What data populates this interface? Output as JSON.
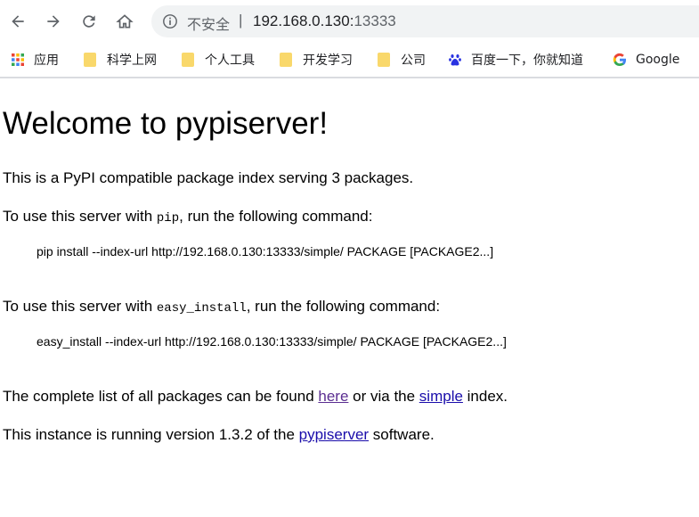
{
  "browser": {
    "security_label": "不安全",
    "url_host": "192.168.0.130:",
    "url_port": "13333",
    "bookmarks": [
      {
        "label": "应用",
        "icon": "apps-grid-icon"
      },
      {
        "label": "科学上网",
        "icon": "folder-icon"
      },
      {
        "label": "个人工具",
        "icon": "folder-icon"
      },
      {
        "label": "开发学习",
        "icon": "folder-icon"
      },
      {
        "label": "公司",
        "icon": "folder-icon"
      },
      {
        "label": "百度一下，你就知道",
        "icon": "baidu-paw-icon"
      },
      {
        "label": "Google",
        "icon": "google-g-icon"
      }
    ]
  },
  "page": {
    "heading": "Welcome to pypiserver!",
    "intro": "This is a PyPI compatible package index serving 3 packages.",
    "pip_prefix": "To use this server with ",
    "pip_code": "pip",
    "pip_suffix": ", run the following command:",
    "pip_command": "pip install --index-url http://192.168.0.130:13333/simple/ PACKAGE [PACKAGE2...]",
    "easy_prefix": "To use this server with ",
    "easy_code": "easy_install",
    "easy_suffix": ", run the following command:",
    "easy_command": "easy_install --index-url http://192.168.0.130:13333/simple/ PACKAGE [PACKAGE2...]",
    "list_prefix": "The complete list of all packages can be found ",
    "list_here_link": "here",
    "list_middle": " or via the ",
    "list_simple_link": "simple",
    "list_suffix": " index.",
    "version_prefix": "This instance is running version 1.3.2 of the ",
    "version_link": "pypiserver",
    "version_suffix": " software."
  }
}
